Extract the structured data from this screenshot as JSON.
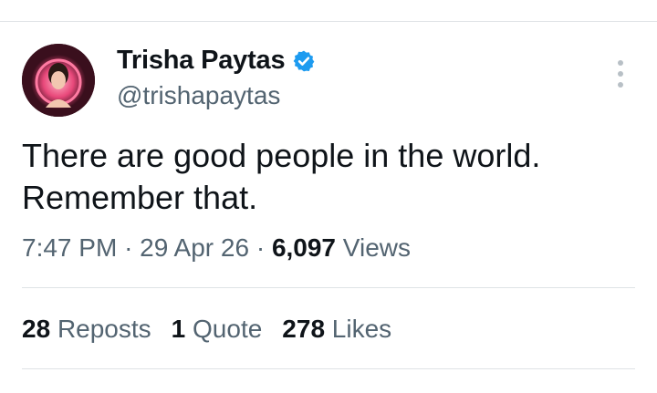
{
  "author": {
    "display_name": "Trisha Paytas",
    "handle": "@trishapaytas",
    "verified_icon": "verified-badge-icon",
    "avatar_accent": "#e8487a"
  },
  "tweet": {
    "lines": [
      "There are good people in the world.",
      "Remember that."
    ]
  },
  "meta": {
    "time": "7:47 PM",
    "separator": "·",
    "date": "29 Apr 26",
    "views_count": "6,097",
    "views_label": "Views"
  },
  "stats": {
    "reposts_count": "28",
    "reposts_label": "Reposts",
    "quote_count": "1",
    "quote_label": "Quote",
    "likes_count": "278",
    "likes_label": "Likes"
  },
  "colors": {
    "text_primary": "#0f1419",
    "text_secondary": "#536471",
    "verified_blue": "#1d9bf0",
    "divider": "#dfe3e6"
  }
}
